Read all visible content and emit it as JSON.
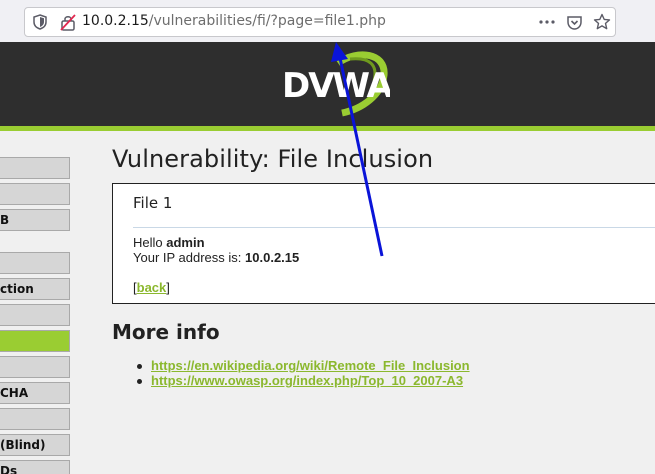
{
  "browser": {
    "url_host": "10.0.2.15",
    "url_path": "/vulnerabilities/fi/?page=file1.php"
  },
  "header": {
    "logo_text": "DVWA"
  },
  "sidebar": {
    "items": [
      {
        "label": ""
      },
      {
        "label": ""
      },
      {
        "label": "B"
      },
      {
        "label": ""
      },
      {
        "label": "ction"
      },
      {
        "label": ""
      },
      {
        "label": "",
        "active": true
      },
      {
        "label": ""
      },
      {
        "label": "CHA"
      },
      {
        "label": ""
      },
      {
        "label": "(Blind)"
      },
      {
        "label": "Ds"
      }
    ]
  },
  "main": {
    "title": "Vulnerability: File Inclusion",
    "box": {
      "heading": "File 1",
      "hello_prefix": "Hello",
      "hello_user": "admin",
      "ip_prefix": "Your IP address is:",
      "ip_value": "10.0.2.15",
      "back_open": "[",
      "back_label": "back",
      "back_close": "]"
    },
    "more_info": {
      "title": "More info",
      "links": [
        "https://en.wikipedia.org/wiki/Remote_File_Inclusion",
        "https://www.owasp.org/index.php/Top_10_2007-A3"
      ]
    }
  },
  "annotation": {
    "arrow_color": "#0a14d8"
  }
}
